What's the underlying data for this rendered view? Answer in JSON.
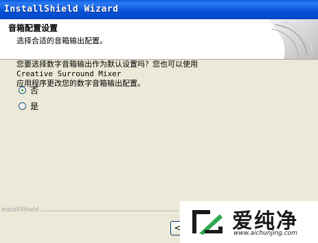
{
  "window": {
    "title": "InstallShield Wizard"
  },
  "header": {
    "title": "音箱配置设置",
    "subtitle": "选择合适的音箱输出配置。"
  },
  "prompt": {
    "line1_prefix": "您要选择数字音箱输出作为默认设置吗？您也可以使用 ",
    "product": "Creative Surround Mixer",
    "line2": "应用程序更改您的数字音箱输出配置。"
  },
  "options": [
    {
      "label": "否",
      "selected": true
    },
    {
      "label": "是",
      "selected": false
    }
  ],
  "footer": {
    "brand": "InstallShield",
    "back_label": "<"
  },
  "watermark": {
    "text": "爱纯净",
    "url": "www.aichunjing.com",
    "accent": "#2fa84f"
  }
}
